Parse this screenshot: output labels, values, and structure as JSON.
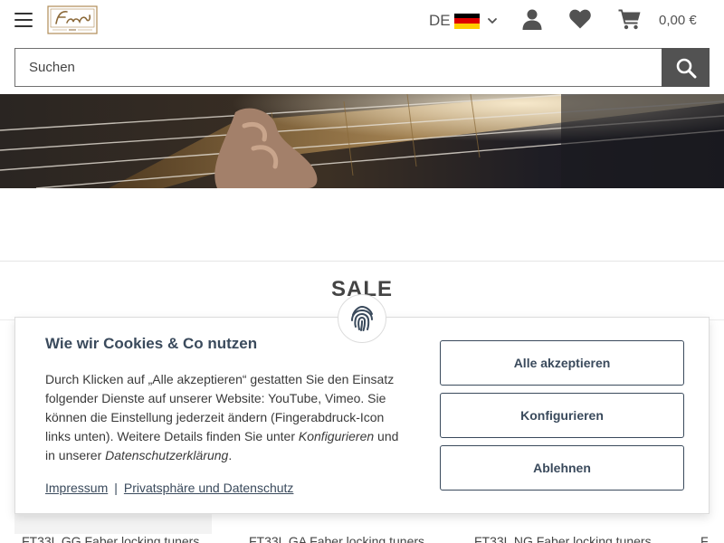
{
  "header": {
    "language": "DE",
    "cart_total": "0,00 €"
  },
  "search": {
    "placeholder": "Suchen"
  },
  "section": {
    "title": "SALE"
  },
  "products": [
    {
      "title": "FT33L GG Faber locking tuners"
    },
    {
      "title": "FT33L GA Faber locking tuners"
    },
    {
      "title": "FT33L NG Faber locking tuners"
    },
    {
      "title": "F"
    }
  ],
  "consent": {
    "title": "Wie wir Cookies & Co nutzen",
    "text_part1": "Durch Klicken auf „Alle akzeptieren“ gestatten Sie den Einsatz folgender Dienste auf unserer Website: YouTube, Vimeo. Sie können die Einstellung jederzeit ändern (Fingerabdruck-Icon links unten). Weitere Details finden Sie unter ",
    "text_em1": "Konfigurieren",
    "text_part2": " und in unserer ",
    "text_em2": "Datenschutzerklärung",
    "text_part3": ".",
    "link_imprint": "Impressum",
    "link_separator": "|",
    "link_privacy": "Privatsphäre und Datenschutz",
    "btn_accept_all": "Alle akzeptieren",
    "btn_configure": "Konfigurieren",
    "btn_reject": "Ablehnen"
  },
  "colors": {
    "accent": "#3a4a5c",
    "search_button": "#525252",
    "flag": [
      "#000000",
      "#dd0000",
      "#ffce00"
    ]
  },
  "icons": [
    "menu-icon",
    "logo",
    "chevron-down-icon",
    "user-icon",
    "heart-icon",
    "cart-icon",
    "search-icon",
    "fingerprint-icon"
  ]
}
